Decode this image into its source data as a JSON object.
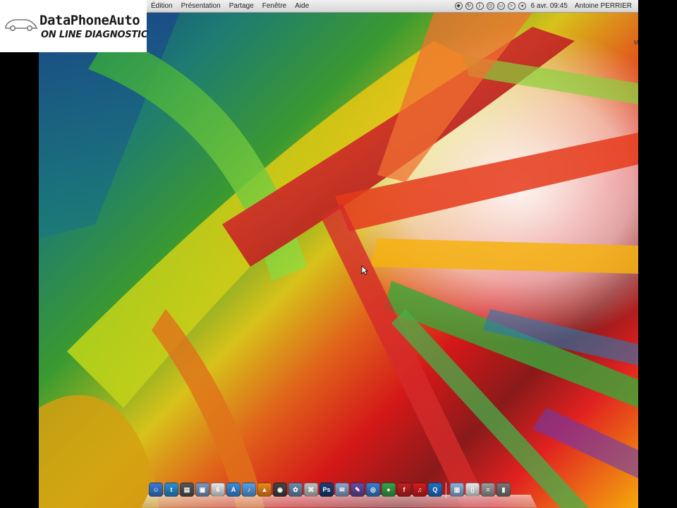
{
  "logo": {
    "brand": "DataPhoneAuto",
    "tagline": "ON LINE DIAGNOSTIC"
  },
  "menubar": {
    "items": [
      "Édition",
      "Présentation",
      "Partage",
      "Fenêtre",
      "Aide"
    ],
    "clock": "6 avr. 09:45",
    "user": "Antoine PERRIER",
    "status_icons": [
      "dropbox-icon",
      "sync-icon",
      "bluetooth-icon",
      "time-machine-icon",
      "battery-icon",
      "wifi-icon",
      "volume-icon"
    ]
  },
  "desktop": {
    "hd_label": "Macintosh HD"
  },
  "dock": {
    "apps": [
      {
        "name": "finder-icon",
        "color": "#3a7bd5",
        "glyph": "☺"
      },
      {
        "name": "twitter-icon",
        "color": "#2a8fd6",
        "glyph": "t"
      },
      {
        "name": "printer-icon",
        "color": "#555555",
        "glyph": "▤"
      },
      {
        "name": "preview-icon",
        "color": "#7a9ac0",
        "glyph": "▣"
      },
      {
        "name": "calendar-icon",
        "color": "#e8e8e8",
        "glyph": "6"
      },
      {
        "name": "app-store-icon",
        "color": "#3b8ee0",
        "glyph": "A"
      },
      {
        "name": "itunes-icon",
        "color": "#5aa0e8",
        "glyph": "♪"
      },
      {
        "name": "vlc-icon",
        "color": "#f08a1c",
        "glyph": "▲"
      },
      {
        "name": "photo-booth-icon",
        "color": "#444444",
        "glyph": "◉"
      },
      {
        "name": "iphoto-icon",
        "color": "#6a8cb0",
        "glyph": "✿"
      },
      {
        "name": "network-icon",
        "color": "#c0c0c0",
        "glyph": "⌘"
      },
      {
        "name": "photoshop-icon",
        "color": "#1b3d7a",
        "glyph": "Ps"
      },
      {
        "name": "mail-icon",
        "color": "#8aa6cc",
        "glyph": "✉"
      },
      {
        "name": "pencil-icon",
        "color": "#6b4aa0",
        "glyph": "✎"
      },
      {
        "name": "safari-icon",
        "color": "#3b7fd0",
        "glyph": "◎"
      },
      {
        "name": "chrome-icon",
        "color": "#3aa34a",
        "glyph": "●"
      },
      {
        "name": "flash-icon",
        "color": "#c42020",
        "glyph": "f"
      },
      {
        "name": "lastfm-icon",
        "color": "#d51c1c",
        "glyph": "♫"
      },
      {
        "name": "quicktime-icon",
        "color": "#2070c8",
        "glyph": "Q"
      }
    ],
    "stacks": [
      {
        "name": "applications-folder-icon",
        "color": "#8fb0d8",
        "glyph": "▥"
      },
      {
        "name": "documents-folder-icon",
        "color": "#e8e8e8",
        "glyph": "▯"
      },
      {
        "name": "downloads-stack-icon",
        "color": "#9a9a9a",
        "glyph": "≡"
      },
      {
        "name": "trash-icon",
        "color": "#777777",
        "glyph": "▮"
      }
    ]
  }
}
